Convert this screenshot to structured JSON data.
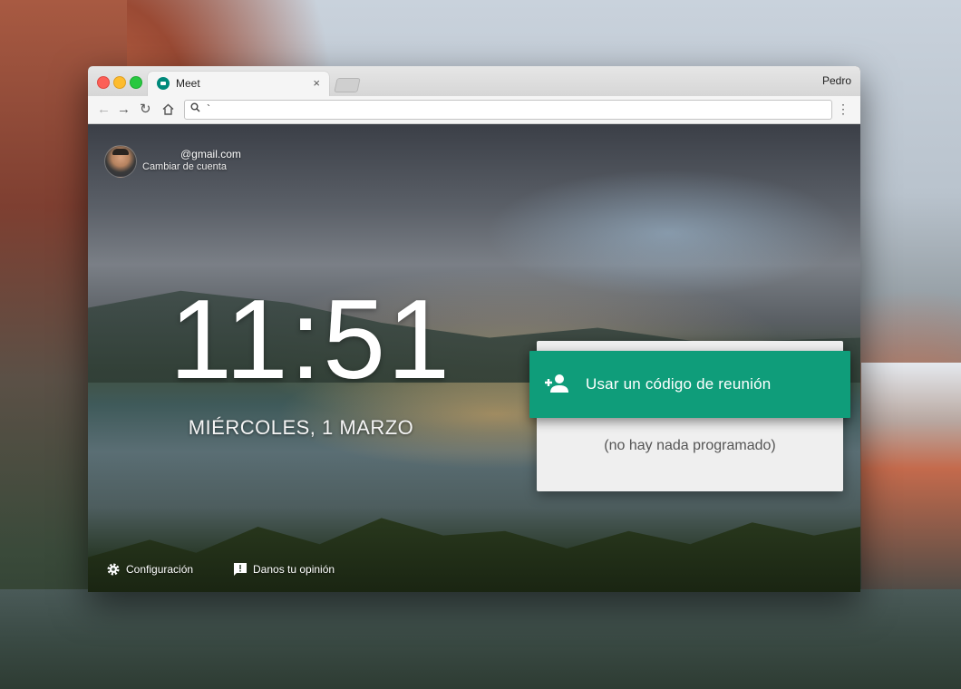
{
  "browser": {
    "tab_title": "Meet",
    "tab_close": "×",
    "profile_name": "Pedro",
    "address_text": "`",
    "icons": {
      "back": "arrow-left",
      "forward": "arrow-right",
      "reload": "reload",
      "home": "home",
      "search": "search",
      "menu": "vertical-dots"
    }
  },
  "account": {
    "email": "@gmail.com",
    "switch_label": "Cambiar de cuenta"
  },
  "clock": {
    "time": "11:51",
    "date": "MIÉRCOLES, 1 MARZO"
  },
  "meeting_card": {
    "action_label": "Usar un código de reunión",
    "empty_state": "(no hay nada programado)",
    "accent_color": "#0f9d7a"
  },
  "footer": {
    "settings_label": "Configuración",
    "feedback_label": "Danos tu opinión"
  }
}
